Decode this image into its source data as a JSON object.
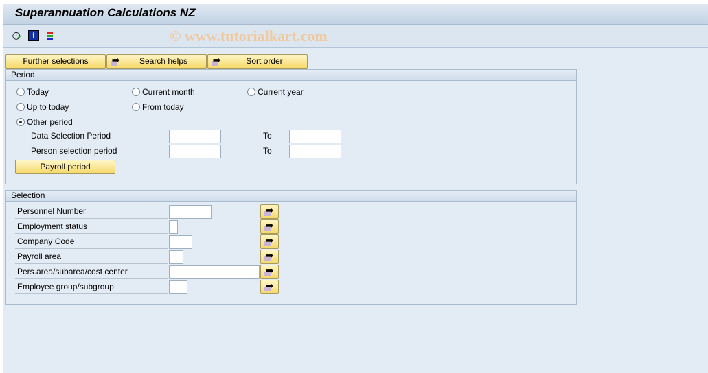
{
  "title": "Superannuation Calculations NZ",
  "watermark": "© www.tutorialkart.com",
  "toolbar": {
    "icons": [
      "execute-icon",
      "info-icon",
      "variants-icon"
    ]
  },
  "tabs": {
    "further": "Further selections",
    "search": "Search helps",
    "sort": "Sort order"
  },
  "period": {
    "header": "Period",
    "radios": [
      {
        "label": "Today",
        "checked": false
      },
      {
        "label": "Current month",
        "checked": false
      },
      {
        "label": "Current year",
        "checked": false
      },
      {
        "label": "Up to today",
        "checked": false
      },
      {
        "label": "From today",
        "checked": false
      },
      {
        "label": "Other period",
        "checked": true
      }
    ],
    "data_sel_label": "Data Selection Period",
    "person_sel_label": "Person selection period",
    "to_label": "To",
    "data_from": "",
    "data_to": "",
    "person_from": "",
    "person_to": "",
    "payroll_button": "Payroll period"
  },
  "selection": {
    "header": "Selection",
    "rows": [
      {
        "label": "Personnel Number",
        "value": ""
      },
      {
        "label": "Employment status",
        "value": ""
      },
      {
        "label": "Company Code",
        "value": ""
      },
      {
        "label": "Payroll area",
        "value": ""
      },
      {
        "label": "Pers.area/subarea/cost center",
        "value": ""
      },
      {
        "label": "Employee group/subgroup",
        "value": ""
      }
    ]
  }
}
